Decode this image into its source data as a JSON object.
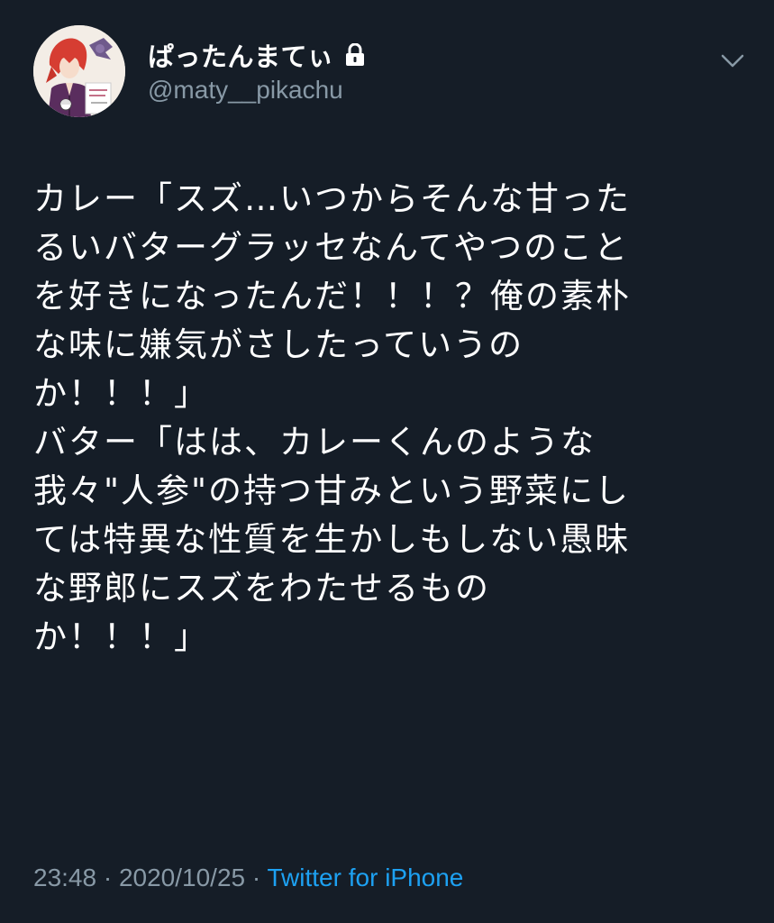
{
  "user": {
    "display_name": "ぱったんまてぃ",
    "handle": "@maty__pikachu",
    "avatar_icon": "profile-avatar-anime-character",
    "protected_icon": "lock-icon"
  },
  "menu": {
    "caret_icon": "chevron-down-icon"
  },
  "tweet": {
    "lines": [
      "カレー「スズ…いつからそんな甘った",
      "るいバターグラッセなんてやつのこと",
      "を好きになったんだ！！！？俺の素朴",
      "な味に嫌気がさしたっていうの",
      "か！！！」",
      "バター「はは、カレーくんのような",
      "我々\"人参\"の持つ甘みという野菜にし",
      "ては特異な性質を生かしもしない愚昧",
      "な野郎にスズをわたせるもの",
      "か！！！」"
    ]
  },
  "meta": {
    "time": "23:48",
    "separator": "·",
    "date": "2020/10/25",
    "source": "Twitter for iPhone"
  },
  "colors": {
    "background": "#151d27",
    "text": "#ffffff",
    "secondary": "#8899a6",
    "link": "#1da1f2"
  }
}
